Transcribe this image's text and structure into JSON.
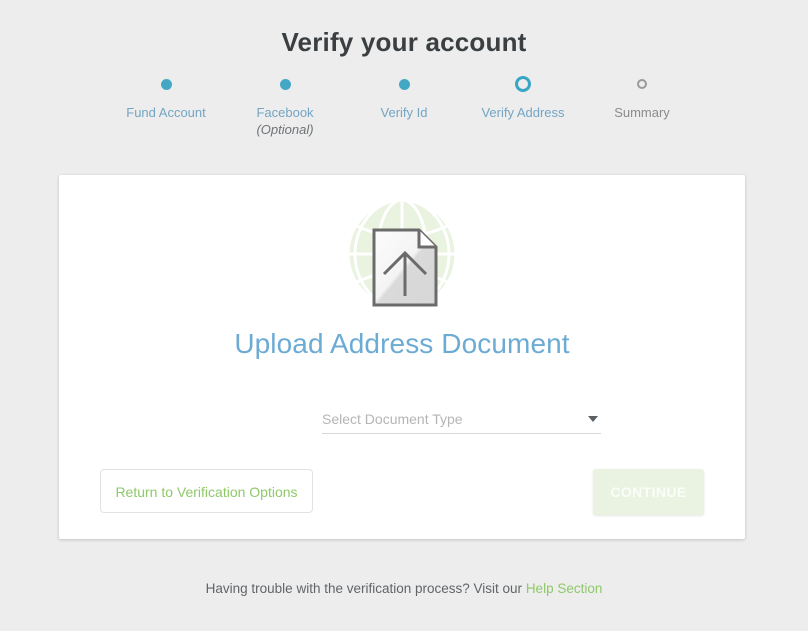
{
  "page": {
    "title": "Verify your account",
    "background_color": "#ecedec"
  },
  "stepper": {
    "accent_color": "#44a8c4",
    "inactive_color": "#9a9a9a",
    "steps": [
      {
        "label": "Fund Account",
        "sub": "",
        "state": "complete",
        "marker": "dot"
      },
      {
        "label": "Facebook",
        "sub": "(Optional)",
        "state": "complete",
        "marker": "dot"
      },
      {
        "label": "Verify Id",
        "sub": "",
        "state": "complete",
        "marker": "dot"
      },
      {
        "label": "Verify Address",
        "sub": "",
        "state": "current",
        "marker": "ring-active"
      },
      {
        "label": "Summary",
        "sub": "",
        "state": "upcoming",
        "marker": "ring-inactive"
      }
    ]
  },
  "card": {
    "illustration_name": "upload-document-globe-illustration",
    "illustration_globe_color": "#e9f3e0",
    "title": "Upload Address Document",
    "title_color": "#6cabd4",
    "select": {
      "placeholder": "Select Document Type",
      "value": "",
      "options": []
    },
    "buttons": {
      "return_label": "Return to Verification Options",
      "return_color": "#8fc96a",
      "continue_label": "CONTINUE",
      "continue_background": "#eaf3e2",
      "continue_disabled": "true"
    }
  },
  "footer": {
    "text": "Having trouble with the verification process? Visit our",
    "link_label": "Help Section",
    "link_color": "#8fc96a"
  }
}
